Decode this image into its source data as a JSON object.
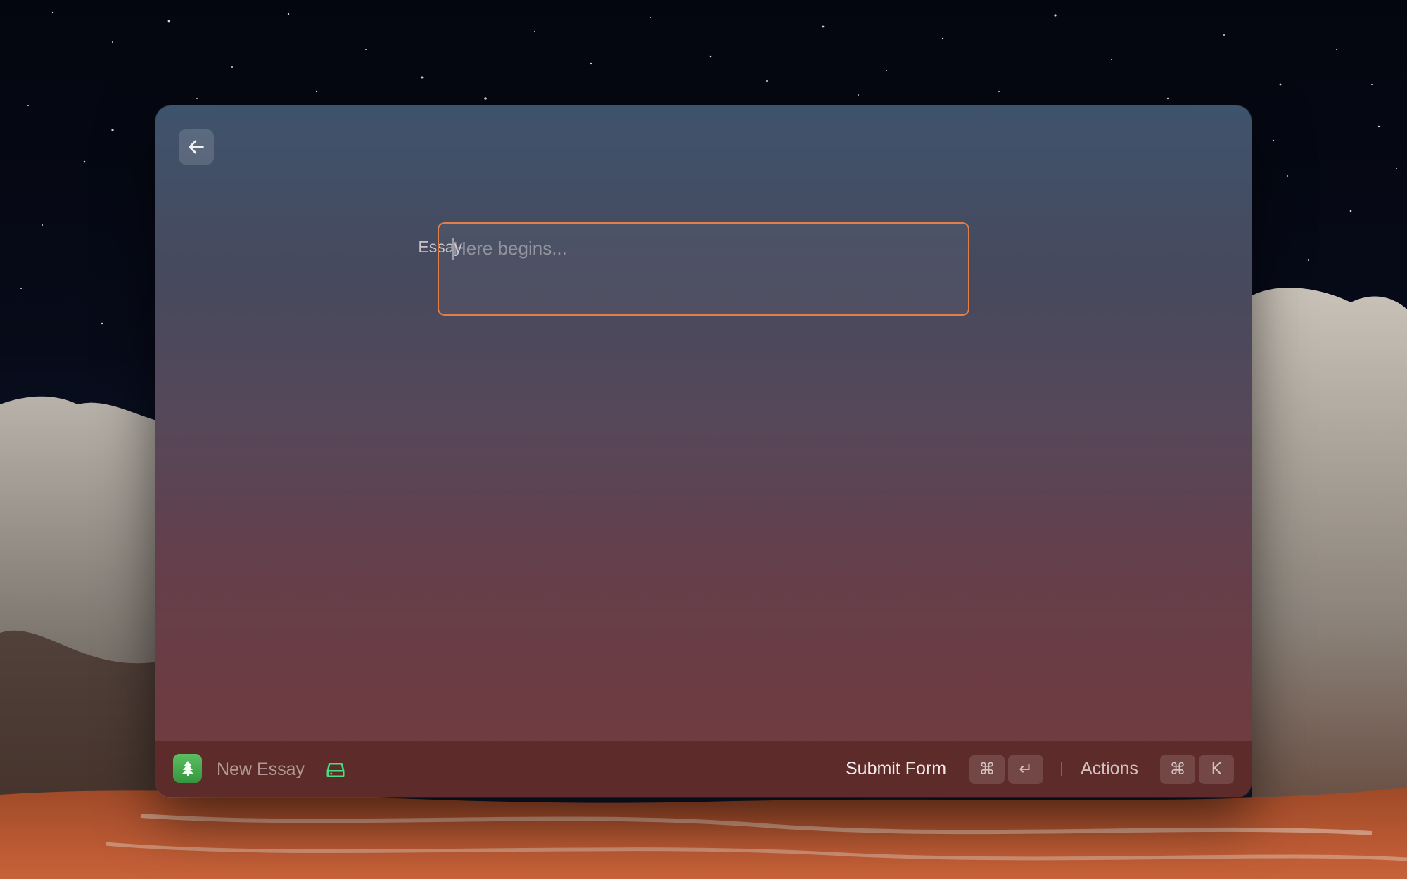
{
  "form": {
    "essay_label": "Essay",
    "essay_value": "",
    "essay_placeholder": "Here begins..."
  },
  "action_bar": {
    "navigation_title": "New Essay",
    "primary_action_label": "Submit Form",
    "primary_action_shortcut": [
      "⌘",
      "↵"
    ],
    "actions_label": "Actions",
    "actions_shortcut": [
      "⌘",
      "K"
    ]
  },
  "icons": {
    "back": "arrow-left-icon",
    "app": "tree-icon",
    "status": "hard-drive-icon"
  },
  "colors": {
    "focus_border": "#e27f46",
    "app_icon_bg": "#4caf50",
    "drive_icon": "#4ade80",
    "action_bar_bg": "#5d2c2a"
  }
}
